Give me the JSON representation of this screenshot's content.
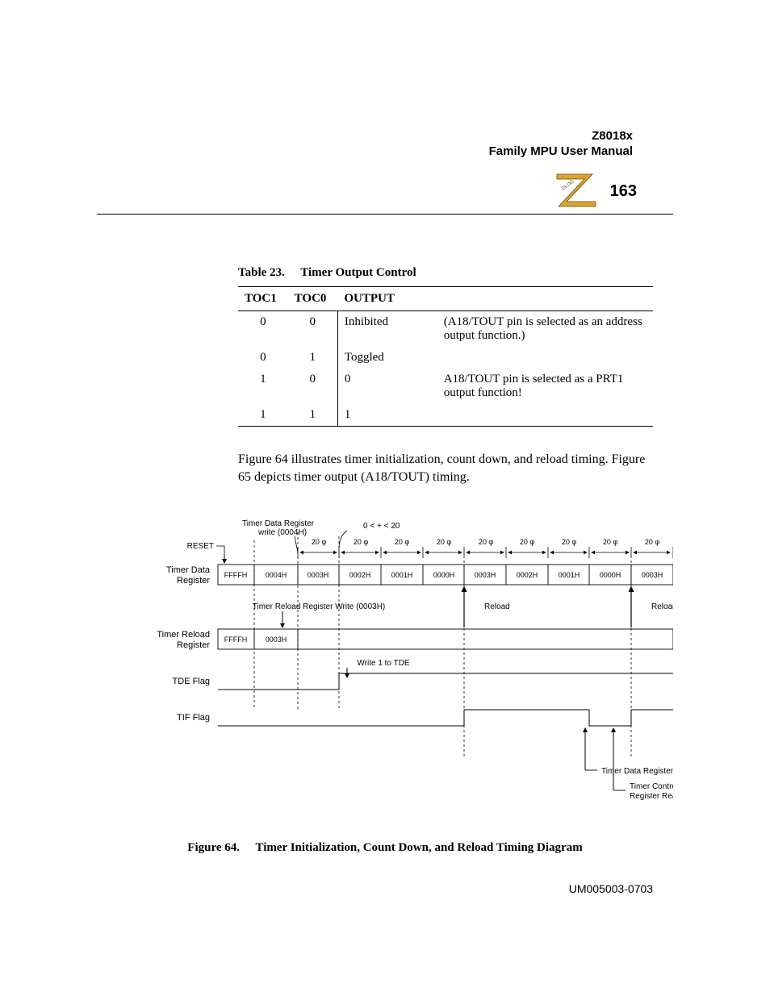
{
  "header": {
    "model": "Z8018x",
    "subtitle": "Family MPU User Manual",
    "page_number": "163",
    "logo_text": "ZiLOG"
  },
  "table": {
    "caption_num": "Table 23.",
    "caption_title": "Timer Output Control",
    "columns": [
      "TOC1",
      "TOC0",
      "OUTPUT",
      ""
    ],
    "rows": [
      {
        "toc1": "0",
        "toc0": "0",
        "output": "Inhibited",
        "note": "(A18/TOUT pin is selected as an address output function.)"
      },
      {
        "toc1": "0",
        "toc0": "1",
        "output": "Toggled",
        "note": ""
      },
      {
        "toc1": "1",
        "toc0": "0",
        "output": "0",
        "note": "A18/TOUT pin is selected as a PRT1 output function!"
      },
      {
        "toc1": "1",
        "toc0": "1",
        "output": "1",
        "note": ""
      }
    ]
  },
  "paragraph": "Figure 64 illustrates timer initialization, count down, and reload timing. Figure 65 depicts timer output (A18/TOUT) timing.",
  "diagram": {
    "top_labels": {
      "tdr_write": "Timer Data Register\nwrite (0004H)",
      "reset": "RESET",
      "interval_note": "0 < + < 20"
    },
    "phi_intervals": [
      "20 φ",
      "20 φ",
      "20 φ",
      "20 φ",
      "20 φ",
      "20 φ",
      "20 φ",
      "20 φ",
      "20 φ"
    ],
    "rows": {
      "tdr": {
        "label": "Timer Data\nRegister",
        "cells": [
          "FFFFH",
          "0004H",
          "0003H",
          "0002H",
          "0001H",
          "0000H",
          "0003H",
          "0002H",
          "0001H",
          "0000H",
          "0003H"
        ]
      },
      "trr": {
        "label": "Timer Reload\nRegister",
        "cells": [
          "FFFFH",
          "0003H"
        ],
        "write_label": "Timer Reload Register Write (0003H)",
        "reload_label_1": "Reload",
        "reload_label_2": "Reload"
      },
      "tde": {
        "label": "TDE Flag",
        "note": "Write 1 to TDE"
      },
      "tif": {
        "label": "TIF Flag"
      }
    },
    "callouts": {
      "tdr_read": "Timer Data Register Read",
      "tcr_read": "Timer Control\nRegister Read"
    },
    "caption_num": "Figure 64.",
    "caption_title": "Timer Initialization, Count Down, and Reload Timing Diagram"
  },
  "footer": "UM005003-0703"
}
